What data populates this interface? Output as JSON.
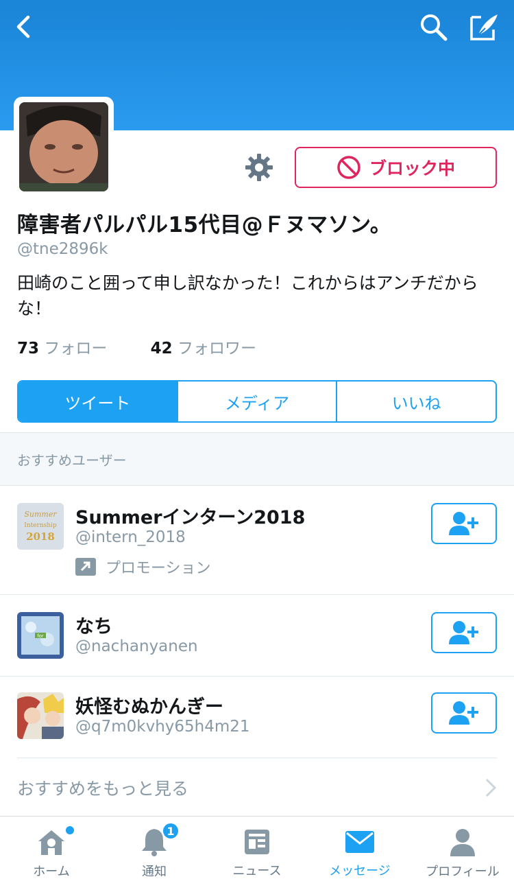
{
  "colors": {
    "brand": "#1da1f2",
    "header": "#1a84d6",
    "block": "#e0245e",
    "muted": "#8899a6"
  },
  "header": {
    "back_icon": "chevron-left-icon",
    "search_icon": "search-icon",
    "compose_icon": "compose-tweet-icon"
  },
  "profile": {
    "name": "障害者パルパル15代目@Ｆヌマソン。",
    "handle": "@tne2896k",
    "bio": "田崎のこと囲って申し訳なかった！これからはアンチだからな！",
    "block_label": "ブロック中",
    "following_count": "73",
    "following_label": "フォロー",
    "followers_count": "42",
    "followers_label": "フォロワー"
  },
  "tabs": [
    {
      "label": "ツイート",
      "active": true
    },
    {
      "label": "メディア",
      "active": false
    },
    {
      "label": "いいね",
      "active": false
    }
  ],
  "suggestions": {
    "heading": "おすすめユーザー",
    "users": [
      {
        "name": "Summerインターン2018",
        "handle": "@intern_2018",
        "promo": "プロモーション",
        "avatar_text": "Summer Internship 2018"
      },
      {
        "name": "なち",
        "handle": "@nachanyanen"
      },
      {
        "name": "妖怪むぬかんぎー",
        "handle": "@q7m0kvhy65h4m21"
      }
    ],
    "more_label": "おすすめをもっと見る"
  },
  "tabbar": [
    {
      "label": "ホーム",
      "icon": "home-icon",
      "dot": true
    },
    {
      "label": "通知",
      "icon": "bell-icon",
      "badge": "1"
    },
    {
      "label": "ニュース",
      "icon": "news-icon"
    },
    {
      "label": "メッセージ",
      "icon": "envelope-icon",
      "active": true
    },
    {
      "label": "プロフィール",
      "icon": "person-icon"
    }
  ]
}
